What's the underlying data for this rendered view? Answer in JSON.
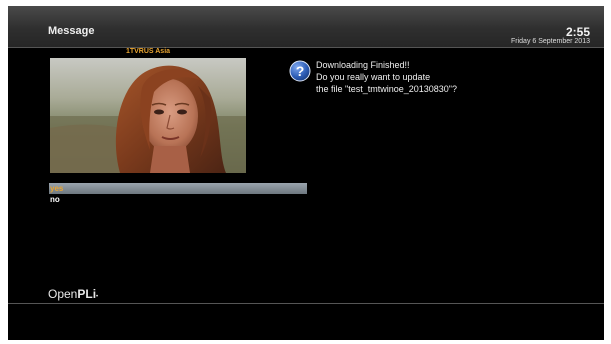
{
  "window": {
    "title": "Message",
    "clock": "2:55",
    "date": "Friday 6 September 2013"
  },
  "preview": {
    "channel_name": "1TVRUS Asia",
    "image_description": "video-preview-woman-face"
  },
  "message": {
    "icon": "question-icon",
    "lines": [
      "Downloading Finished!!",
      "Do you really want to update",
      "the file \"test_tmtwinoe_20130830\"?"
    ]
  },
  "choices": {
    "items": [
      {
        "label": "yes",
        "selected": true
      },
      {
        "label": "no",
        "selected": false
      }
    ]
  },
  "branding": {
    "logo_light": "Open",
    "logo_bold": "PLi",
    "logo_mark": "•"
  },
  "colors": {
    "background": "#000000",
    "titlebar": "#3a3a3a",
    "accent_orange": "#e9a531",
    "selection_bar": "#8a949c",
    "icon_blue": "#2f5fb8"
  }
}
